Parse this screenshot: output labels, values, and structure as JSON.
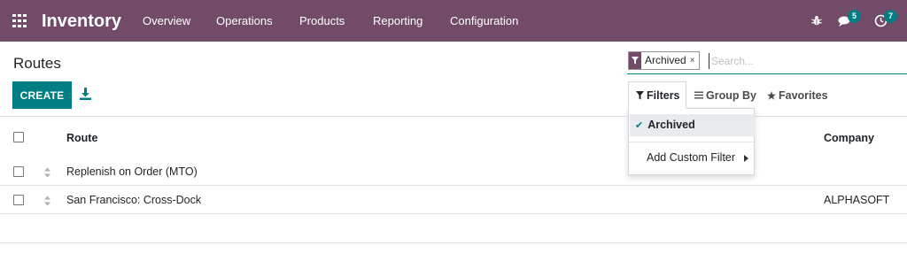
{
  "app": {
    "title": "Inventory"
  },
  "nav": {
    "menus": [
      "Overview",
      "Operations",
      "Products",
      "Reporting",
      "Configuration"
    ]
  },
  "systray": {
    "messages_count": "5",
    "activities_count": "7",
    "icons": [
      "bug-icon",
      "chat-icon",
      "clock-icon"
    ]
  },
  "page": {
    "title": "Routes"
  },
  "toolbar": {
    "create_label": "CREATE"
  },
  "search": {
    "facet_label": "Archived",
    "facet_close": "×",
    "placeholder": "Search...",
    "value": ""
  },
  "search_options": {
    "filters_label": "Filters",
    "groupby_label": "Group By",
    "favorites_label": "Favorites"
  },
  "filters_dropdown": {
    "active_item": "Archived",
    "custom_filter_label": "Add Custom Filter"
  },
  "table": {
    "columns": [
      "Route",
      "Company"
    ],
    "rows": [
      {
        "route": "Replenish on Order (MTO)",
        "company": ""
      },
      {
        "route": "San Francisco: Cross-Dock",
        "company": "ALPHASOFT"
      }
    ]
  },
  "colors": {
    "navbar": "#714b67",
    "primary": "#017e84"
  }
}
